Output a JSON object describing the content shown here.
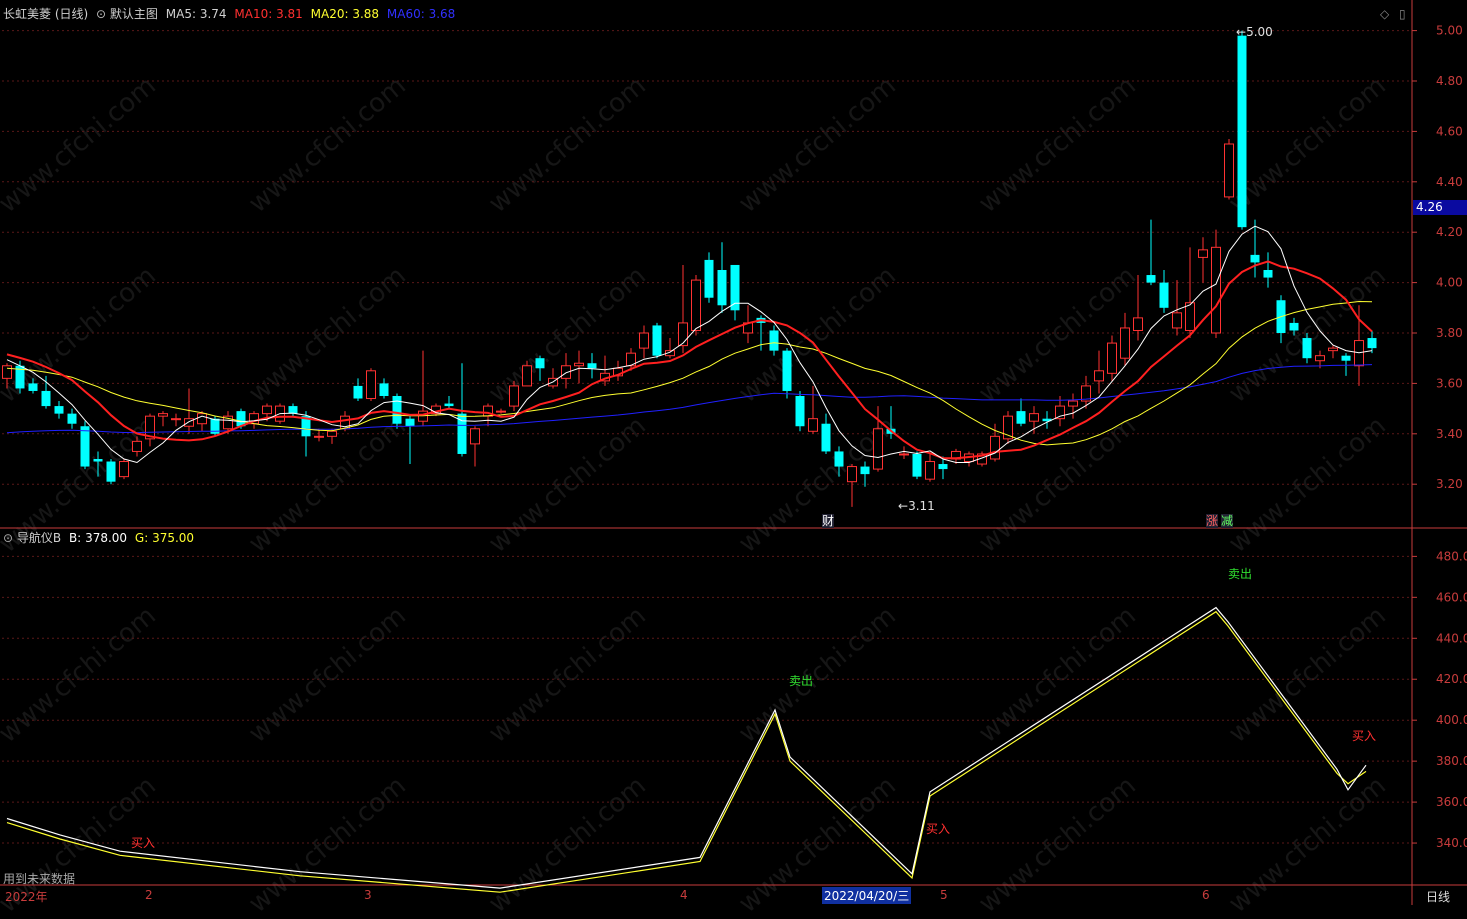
{
  "header": {
    "stock_name": "长虹美菱 (日线)",
    "chart_name": "默认主图",
    "ma5_label": "MA5:",
    "ma5_value": "3.74",
    "ma10_label": "MA10:",
    "ma10_value": "3.81",
    "ma20_label": "MA20:",
    "ma20_value": "3.88",
    "ma60_label": "MA60:",
    "ma60_value": "3.68"
  },
  "indicator_header": {
    "name": "导航仪B",
    "b_label": "B:",
    "b_value": "378.00",
    "g_label": "G:",
    "g_value": "375.00"
  },
  "price_axis": [
    "5.00",
    "4.80",
    "4.60",
    "4.40",
    "4.20",
    "4.00",
    "3.80",
    "3.60",
    "3.40",
    "3.20"
  ],
  "indicator_axis": [
    "480.0",
    "460.0",
    "440.0",
    "420.0",
    "400.0",
    "380.0",
    "360.0",
    "340.0"
  ],
  "current_price_tag": "4.26",
  "high_marker": "5.00",
  "low_marker": "3.11",
  "event_labels": {
    "fin": "财",
    "zhang": "涨",
    "jian": "减"
  },
  "signals": {
    "buy1": "买入",
    "sell1": "卖出",
    "buy2": "买入",
    "sell2": "卖出",
    "buy3": "买入"
  },
  "future_data_note": "用到未来数据",
  "date_axis": {
    "year": "2022年",
    "m2": "2",
    "m3": "3",
    "m4": "4",
    "cursor_date": "2022/04/20/三",
    "m5": "5",
    "m6": "6"
  },
  "period_button": "日线",
  "watermark": "www.cfchi.com",
  "colors": {
    "up": "#ff3232",
    "down": "#00ffff",
    "ma5": "#ffffff",
    "ma10": "#ff2020",
    "ma20": "#ffff30",
    "ma60": "#2020ff",
    "axis": "#c83c3c",
    "buy": "#ff3030",
    "sell": "#30e030"
  },
  "chart_data": {
    "type": "candlestick",
    "ylim": [
      3.05,
      5.05
    ],
    "candles": [
      [
        3.62,
        3.67,
        3.58,
        3.68
      ],
      [
        3.67,
        3.58,
        3.56,
        3.69
      ],
      [
        3.6,
        3.57,
        3.56,
        3.62
      ],
      [
        3.57,
        3.51,
        3.5,
        3.63
      ],
      [
        3.51,
        3.48,
        3.46,
        3.53
      ],
      [
        3.48,
        3.44,
        3.42,
        3.5
      ],
      [
        3.43,
        3.27,
        3.26,
        3.45
      ],
      [
        3.3,
        3.29,
        3.23,
        3.33
      ],
      [
        3.29,
        3.21,
        3.2,
        3.3
      ],
      [
        3.23,
        3.29,
        3.22,
        3.3
      ],
      [
        3.33,
        3.37,
        3.31,
        3.39
      ],
      [
        3.38,
        3.47,
        3.35,
        3.48
      ],
      [
        3.47,
        3.48,
        3.43,
        3.49
      ],
      [
        3.46,
        3.46,
        3.43,
        3.48
      ],
      [
        3.43,
        3.46,
        3.4,
        3.58
      ],
      [
        3.44,
        3.48,
        3.41,
        3.49
      ],
      [
        3.46,
        3.4,
        3.39,
        3.47
      ],
      [
        3.42,
        3.47,
        3.4,
        3.49
      ],
      [
        3.49,
        3.43,
        3.42,
        3.5
      ],
      [
        3.44,
        3.48,
        3.42,
        3.49
      ],
      [
        3.48,
        3.51,
        3.45,
        3.52
      ],
      [
        3.45,
        3.51,
        3.44,
        3.52
      ],
      [
        3.51,
        3.48,
        3.47,
        3.52
      ],
      [
        3.47,
        3.39,
        3.31,
        3.49
      ],
      [
        3.39,
        3.39,
        3.37,
        3.42
      ],
      [
        3.39,
        3.41,
        3.36,
        3.42
      ],
      [
        3.42,
        3.47,
        3.41,
        3.49
      ],
      [
        3.59,
        3.54,
        3.53,
        3.62
      ],
      [
        3.54,
        3.65,
        3.53,
        3.66
      ],
      [
        3.6,
        3.55,
        3.54,
        3.62
      ],
      [
        3.55,
        3.44,
        3.42,
        3.56
      ],
      [
        3.46,
        3.43,
        3.28,
        3.47
      ],
      [
        3.45,
        3.49,
        3.43,
        3.73
      ],
      [
        3.48,
        3.51,
        3.47,
        3.52
      ],
      [
        3.52,
        3.51,
        3.5,
        3.55
      ],
      [
        3.48,
        3.32,
        3.31,
        3.68
      ],
      [
        3.36,
        3.42,
        3.27,
        3.43
      ],
      [
        3.47,
        3.51,
        3.43,
        3.52
      ],
      [
        3.49,
        3.49,
        3.48,
        3.5
      ],
      [
        3.51,
        3.59,
        3.49,
        3.61
      ],
      [
        3.59,
        3.67,
        3.59,
        3.69
      ],
      [
        3.7,
        3.66,
        3.61,
        3.71
      ],
      [
        3.59,
        3.62,
        3.58,
        3.66
      ],
      [
        3.62,
        3.67,
        3.58,
        3.72
      ],
      [
        3.67,
        3.68,
        3.6,
        3.73
      ],
      [
        3.68,
        3.66,
        3.62,
        3.72
      ],
      [
        3.61,
        3.64,
        3.59,
        3.71
      ],
      [
        3.63,
        3.66,
        3.61,
        3.69
      ],
      [
        3.67,
        3.72,
        3.65,
        3.74
      ],
      [
        3.74,
        3.8,
        3.7,
        3.83
      ],
      [
        3.83,
        3.71,
        3.7,
        3.84
      ],
      [
        3.71,
        3.73,
        3.7,
        3.78
      ],
      [
        3.75,
        3.84,
        3.72,
        4.07
      ],
      [
        3.81,
        4.01,
        3.79,
        4.03
      ],
      [
        4.09,
        3.94,
        3.92,
        4.12
      ],
      [
        4.05,
        3.91,
        3.88,
        4.16
      ],
      [
        4.07,
        3.89,
        3.85,
        4.05
      ],
      [
        3.8,
        3.84,
        3.76,
        3.91
      ],
      [
        3.86,
        3.84,
        3.73,
        3.87
      ],
      [
        3.81,
        3.73,
        3.71,
        3.83
      ],
      [
        3.73,
        3.57,
        3.54,
        3.74
      ],
      [
        3.55,
        3.43,
        3.41,
        3.57
      ],
      [
        3.41,
        3.46,
        3.4,
        3.59
      ],
      [
        3.44,
        3.33,
        3.32,
        3.48
      ],
      [
        3.33,
        3.27,
        3.23,
        3.35
      ],
      [
        3.21,
        3.27,
        3.11,
        3.28
      ],
      [
        3.27,
        3.24,
        3.19,
        3.29
      ],
      [
        3.26,
        3.42,
        3.25,
        3.51
      ],
      [
        3.42,
        3.4,
        3.38,
        3.51
      ],
      [
        3.32,
        3.32,
        3.3,
        3.35
      ],
      [
        3.32,
        3.23,
        3.22,
        3.33
      ],
      [
        3.22,
        3.29,
        3.21,
        3.32
      ],
      [
        3.28,
        3.26,
        3.22,
        3.31
      ],
      [
        3.3,
        3.33,
        3.28,
        3.34
      ],
      [
        3.29,
        3.32,
        3.27,
        3.33
      ],
      [
        3.28,
        3.32,
        3.27,
        3.33
      ],
      [
        3.3,
        3.39,
        3.29,
        3.44
      ],
      [
        3.38,
        3.47,
        3.36,
        3.49
      ],
      [
        3.49,
        3.44,
        3.43,
        3.54
      ],
      [
        3.45,
        3.48,
        3.4,
        3.51
      ],
      [
        3.46,
        3.45,
        3.42,
        3.49
      ],
      [
        3.46,
        3.51,
        3.43,
        3.55
      ],
      [
        3.51,
        3.53,
        3.46,
        3.56
      ],
      [
        3.53,
        3.59,
        3.5,
        3.63
      ],
      [
        3.61,
        3.65,
        3.56,
        3.73
      ],
      [
        3.64,
        3.76,
        3.61,
        3.79
      ],
      [
        3.7,
        3.82,
        3.67,
        3.88
      ],
      [
        3.81,
        3.86,
        3.77,
        4.03
      ],
      [
        4.03,
        4.0,
        3.99,
        4.25
      ],
      [
        4.0,
        3.9,
        3.88,
        4.05
      ],
      [
        3.82,
        3.88,
        3.79,
        4.01
      ],
      [
        3.81,
        3.92,
        3.78,
        4.14
      ],
      [
        4.1,
        4.13,
        4.0,
        4.18
      ],
      [
        3.8,
        4.14,
        3.78,
        4.21
      ],
      [
        4.34,
        4.55,
        4.33,
        4.57
      ],
      [
        4.98,
        4.22,
        4.21,
        5.0
      ],
      [
        4.11,
        4.08,
        4.02,
        4.25
      ],
      [
        4.05,
        4.02,
        3.98,
        4.12
      ],
      [
        3.93,
        3.8,
        3.76,
        3.95
      ],
      [
        3.84,
        3.81,
        3.79,
        3.86
      ],
      [
        3.78,
        3.7,
        3.68,
        3.8
      ],
      [
        3.69,
        3.71,
        3.66,
        3.73
      ],
      [
        3.73,
        3.74,
        3.7,
        3.75
      ],
      [
        3.71,
        3.69,
        3.63,
        3.72
      ],
      [
        3.67,
        3.77,
        3.59,
        3.91
      ],
      [
        3.78,
        3.74,
        3.72,
        3.81
      ]
    ],
    "indicator": {
      "ylim": [
        320,
        488
      ],
      "b": [
        352,
        344,
        336,
        326,
        318,
        333,
        405,
        382,
        325,
        365,
        455,
        448,
        376,
        366,
        378
      ],
      "g": [
        350,
        342,
        334,
        324,
        316,
        331,
        403,
        380,
        323,
        363,
        453,
        446,
        374,
        369,
        375
      ]
    }
  }
}
